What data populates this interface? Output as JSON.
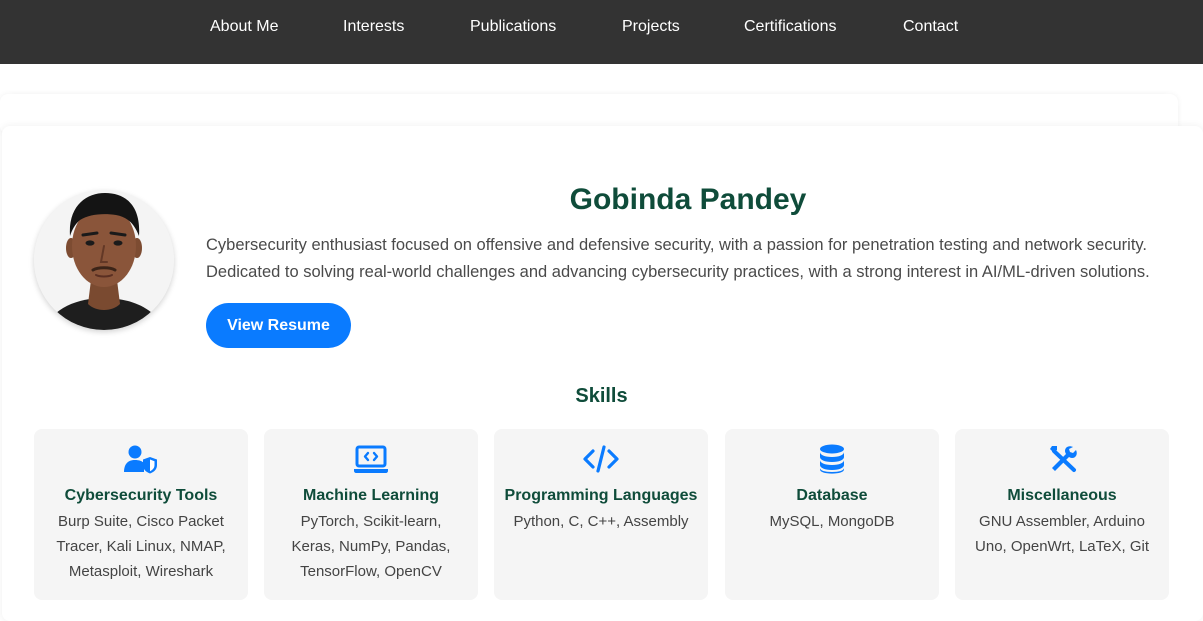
{
  "nav": {
    "items": [
      "About Me",
      "Interests",
      "Publications",
      "Projects",
      "Certifications",
      "Contact"
    ]
  },
  "profile": {
    "name": "Gobinda Pandey",
    "bio_line1": "Cybersecurity enthusiast focused on offensive and defensive security, with a passion for penetration testing and network security.",
    "bio_line2": "Dedicated to solving real-world challenges and advancing cybersecurity practices, with a strong interest in AI/ML-driven solutions.",
    "resume_button": "View Resume"
  },
  "skills": {
    "title": "Skills",
    "accent_color": "#0a7bff",
    "cards": [
      {
        "icon": "user-shield-icon",
        "name": "Cybersecurity Tools",
        "items": "Burp Suite, Cisco Packet Tracer, Kali Linux, NMAP, Metasploit, Wireshark"
      },
      {
        "icon": "laptop-code-icon",
        "name": "Machine Learning",
        "items": "PyTorch, Scikit-learn, Keras, NumPy, Pandas, TensorFlow, OpenCV"
      },
      {
        "icon": "code-icon",
        "name": "Programming Languages",
        "items": "Python, C, C++, Assembly"
      },
      {
        "icon": "database-icon",
        "name": "Database",
        "items": "MySQL, MongoDB"
      },
      {
        "icon": "tools-icon",
        "name": "Miscellaneous",
        "items": "GNU Assembler, Arduino Uno, OpenWrt, LaTeX, Git"
      }
    ]
  }
}
